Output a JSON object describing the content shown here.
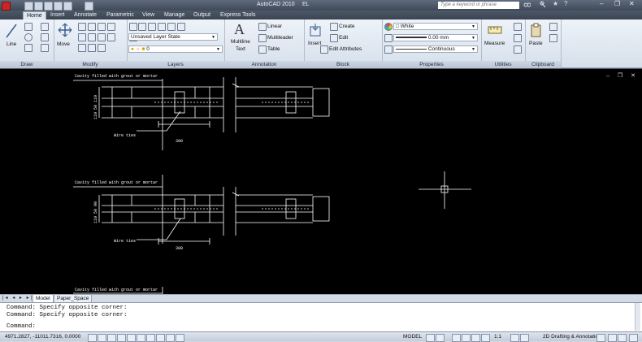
{
  "app": {
    "title": "AutoCAD 2010",
    "file_label": "EL",
    "search_placeholder": "Type a keyword or phrase"
  },
  "ribbon_tabs": [
    "Home",
    "Insert",
    "Annotate",
    "Parametric",
    "View",
    "Manage",
    "Output",
    "Express Tools"
  ],
  "ribbon": {
    "draw": {
      "title": "Draw",
      "line": "Line"
    },
    "modify": {
      "title": "Modify",
      "move": "Move"
    },
    "layers": {
      "title": "Layers",
      "layer_state": "Unsaved Layer State",
      "current_layer": "0"
    },
    "annotation": {
      "title": "Annotation",
      "mtext": "Multiline\nText",
      "linear": "Linear",
      "multileader": "Multileader",
      "table": "Table"
    },
    "block": {
      "title": "Block",
      "insert": "Insert",
      "create": "Create",
      "edit": "Edit",
      "edit_attr": "Edit Attributes"
    },
    "properties": {
      "title": "Properties",
      "color": "White",
      "lineweight": "0.00 mm",
      "linetype": "Continuous"
    },
    "utilities": {
      "title": "Utilities",
      "measure": "Measure"
    },
    "clipboard": {
      "title": "Clipboard",
      "paste": "Paste"
    }
  },
  "drawing": {
    "note": "Cavity filled with grout or mortar",
    "wire_ties": "Wire ties",
    "dim_300": "300",
    "dims_vertical_1": "110  50  110",
    "dims_vertical_2": "110  50  90"
  },
  "layout_tabs": [
    "Model",
    "Paper_Space"
  ],
  "command_lines": [
    "Command: Specify opposite corner:",
    "Command: Specify opposite corner:",
    "Command:"
  ],
  "status": {
    "coords": "4971.2827, -11011.7316, 0.0000",
    "model": "MODEL",
    "scale": "1:1",
    "workspace": "2D Drafting & Annotation"
  },
  "colors": {
    "canvas": "#000000",
    "lines": "#ffffff",
    "ribbon": "#dde5f0"
  }
}
